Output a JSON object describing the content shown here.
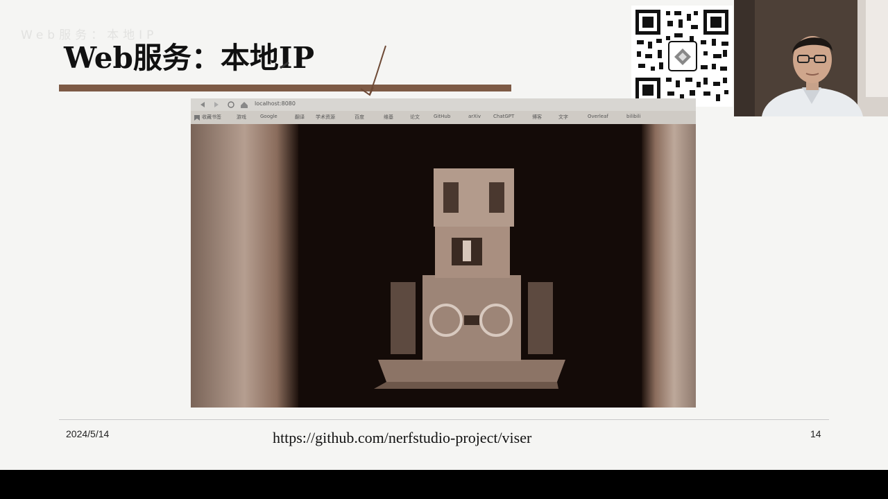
{
  "slide": {
    "faint_title": "Web服务：本地IP",
    "title": "Web服务：本地IP",
    "footer_date": "2024/5/14",
    "footer_link": "https://github.com/nerfstudio-project/viser",
    "page_number": "14"
  },
  "browser": {
    "url": "localhost:8080",
    "bookmarks": [
      "收藏书签",
      "游戏",
      "Google",
      "翻译",
      "学术资源",
      "百度",
      "维基",
      "论文",
      "GitHub",
      "arXiv",
      "ChatGPT",
      "博客",
      "文字",
      "Overleaf",
      "bilibili"
    ]
  },
  "colors": {
    "title_bar": "#7d5a45",
    "slide_bg": "#f5f5f3",
    "viewport_bg": "#140b08"
  },
  "icons": [
    "qr-code-icon",
    "back-icon",
    "forward-icon",
    "reload-icon",
    "home-icon",
    "bookmark-icon"
  ]
}
